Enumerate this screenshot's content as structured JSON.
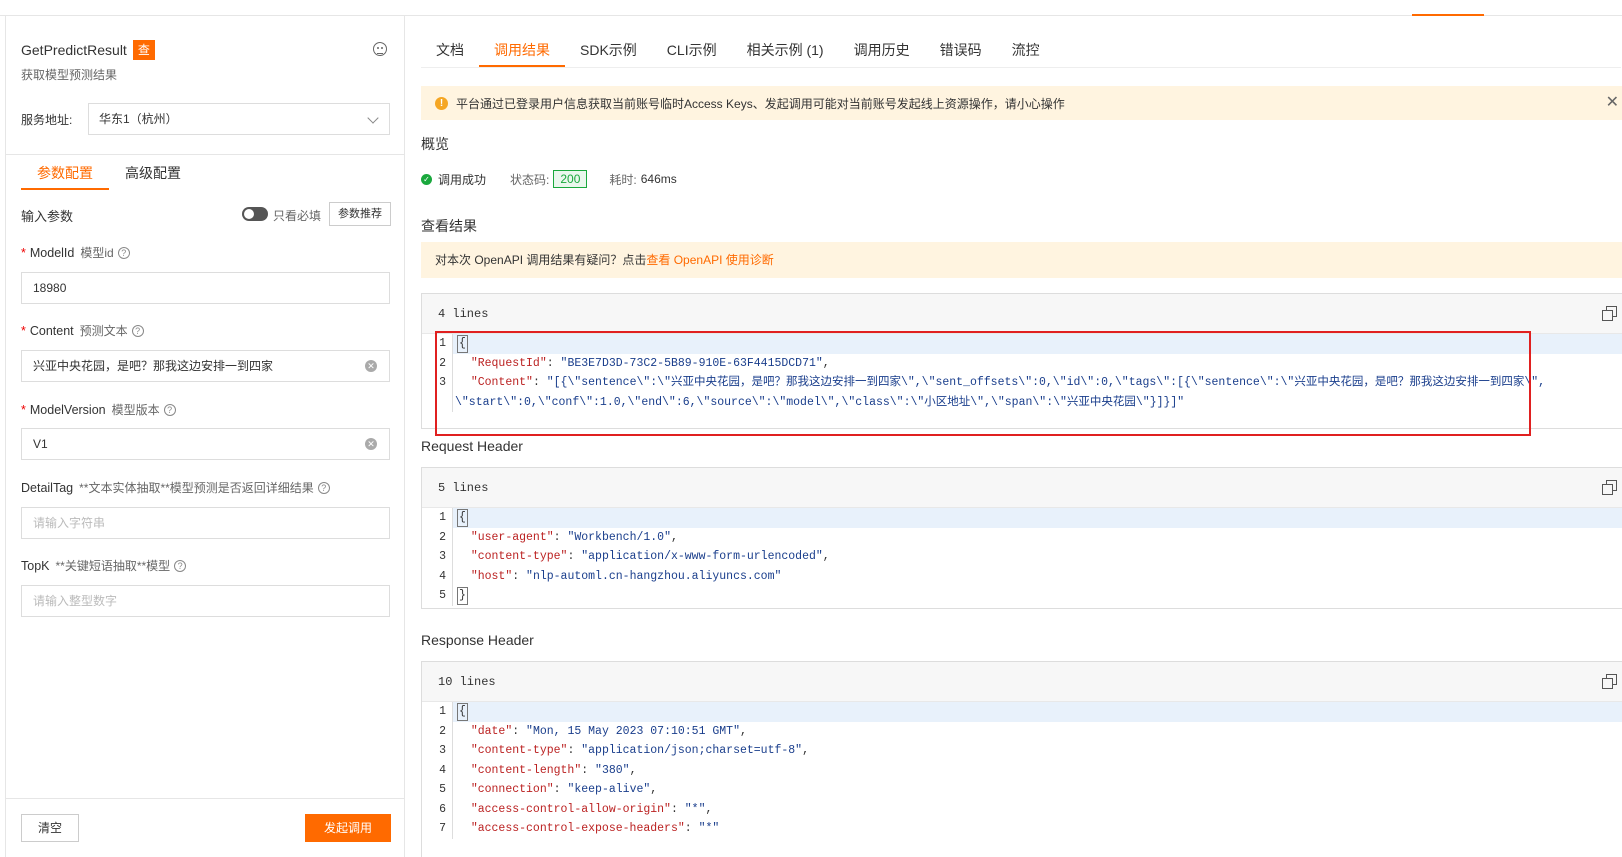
{
  "api": {
    "name": "GetPredictResult",
    "badge": "查",
    "description": "获取模型预测结果"
  },
  "service": {
    "label": "服务地址:",
    "value": "华东1（杭州）"
  },
  "left_tabs": [
    "参数配置",
    "高级配置"
  ],
  "input_params": {
    "title": "输入参数",
    "toggle_label": "只看必填",
    "recommend_button": "参数推荐"
  },
  "fields": [
    {
      "name": "ModelId",
      "sub": "模型id",
      "required": true,
      "value": "18980",
      "placeholder": ""
    },
    {
      "name": "Content",
      "sub": "预测文本",
      "required": true,
      "value": "兴亚中央花园，是吧？那我这边安排一到四家",
      "placeholder": ""
    },
    {
      "name": "ModelVersion",
      "sub": "模型版本",
      "required": true,
      "value": "V1",
      "placeholder": ""
    },
    {
      "name": "DetailTag",
      "sub": "**文本实体抽取**模型预测是否返回详细结果",
      "required": false,
      "value": "",
      "placeholder": "请输入字符串"
    },
    {
      "name": "TopK",
      "sub": "**关键短语抽取**模型",
      "required": false,
      "value": "",
      "placeholder": "请输入整型数字"
    }
  ],
  "bottom_buttons": {
    "clear": "清空",
    "invoke": "发起调用"
  },
  "right_tabs": [
    "文档",
    "调用结果",
    "SDK示例",
    "CLI示例",
    "相关示例 (1)",
    "调用历史",
    "错误码",
    "流控"
  ],
  "notice": "平台通过已登录用户信息获取当前账号临时Access Keys、发起调用可能对当前账号发起线上资源操作，请小心操作",
  "overview": {
    "title": "概览",
    "status": "调用成功",
    "status_code_label": "状态码:",
    "status_code": "200",
    "elapsed_label": "耗时:",
    "elapsed": "646ms"
  },
  "result": {
    "title": "查看结果",
    "diag_text": "对本次 OpenAPI 调用结果有疑问？点击",
    "diag_link": "查看 OpenAPI 使用诊断",
    "lines_label": "4 lines",
    "request_id_key": "\"RequestId\"",
    "request_id_val": "\"BE3E7D3D-73C2-5B89-910E-63F4415DCD71\"",
    "content_key": "\"Content\"",
    "content_val_1": "\"[{\\\"sentence\\\":\\\"兴亚中央花园，是吧？那我这边安排一到四家\\\",\\\"sent_offsets\\\":0,\\\"id\\\":0,\\\"tags\\\":[{\\\"sentence\\\":\\\"兴亚中央花园，是吧？那我这边安排一到四家\\\",",
    "content_val_2": "\\\"start\\\":0,\\\"conf\\\":1.0,\\\"end\\\":6,\\\"source\\\":\\\"model\\\",\\\"class\\\":\\\"小区地址\\\",\\\"span\\\":\\\"兴亚中央花园\\\"}]}]\""
  },
  "request_header": {
    "title": "Request Header",
    "lines_label": "5 lines",
    "entries": [
      {
        "k": "\"user-agent\"",
        "v": "\"Workbench/1.0\""
      },
      {
        "k": "\"content-type\"",
        "v": "\"application/x-www-form-urlencoded\""
      },
      {
        "k": "\"host\"",
        "v": "\"nlp-automl.cn-hangzhou.aliyuncs.com\""
      }
    ]
  },
  "response_header": {
    "title": "Response Header",
    "lines_label": "10 lines",
    "entries": [
      {
        "k": "\"date\"",
        "v": "\"Mon, 15 May 2023 07:10:51 GMT\""
      },
      {
        "k": "\"content-type\"",
        "v": "\"application/json;charset=utf-8\""
      },
      {
        "k": "\"content-length\"",
        "v": "\"380\""
      },
      {
        "k": "\"connection\"",
        "v": "\"keep-alive\""
      },
      {
        "k": "\"access-control-allow-origin\"",
        "v": "\"*\""
      },
      {
        "k": "\"access-control-expose-headers\"",
        "v": "\"*\""
      }
    ]
  },
  "colors": {
    "accent": "#ff6a00",
    "success": "#1aa83d",
    "highlight_box": "#e02020"
  },
  "icons": [
    "help-face-icon",
    "chevron-down-icon",
    "question-icon",
    "clear-icon",
    "warning-icon",
    "close-icon",
    "success-icon",
    "copy-icon"
  ]
}
